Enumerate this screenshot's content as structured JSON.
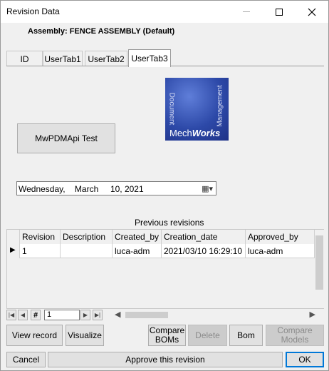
{
  "window": {
    "title": "Revision Data"
  },
  "assembly_label": "Assembly: FENCE ASSEMBLY (Default)",
  "tabs": [
    {
      "label": "ID"
    },
    {
      "label": "UserTab1"
    },
    {
      "label": "UserTab2"
    },
    {
      "label": "UserTab3",
      "active": true
    }
  ],
  "test_button": "MwPDMApi Test",
  "logo": {
    "side_left": "Document",
    "side_right": "Management",
    "brand_plain": "Mech",
    "brand_bold": "Works"
  },
  "date_picker": {
    "value": "Wednesday,    March     10, 2021"
  },
  "previous_revisions": {
    "label": "Previous revisions",
    "columns": [
      "Revision",
      "Description",
      "Created_by",
      "Creation_date",
      "Approved_by"
    ],
    "rows": [
      [
        "1",
        "",
        "luca-adm",
        "2021/03/10 16:29:10",
        "luca-adm"
      ]
    ],
    "row_pointer": "▶"
  },
  "navigator": {
    "first": "|◀",
    "prev": "◀",
    "hash": "#",
    "record": "1",
    "next": "▶",
    "last": "▶|"
  },
  "buttons": {
    "view_record": "View record",
    "visualize": "Visualize",
    "compare_boms_1": "Compare",
    "compare_boms_2": "BOMs",
    "delete": "Delete",
    "bom": "Bom",
    "compare_models_1": "Compare",
    "compare_models_2": "Models",
    "cancel": "Cancel",
    "approve": "Approve this revision",
    "ok": "OK"
  }
}
